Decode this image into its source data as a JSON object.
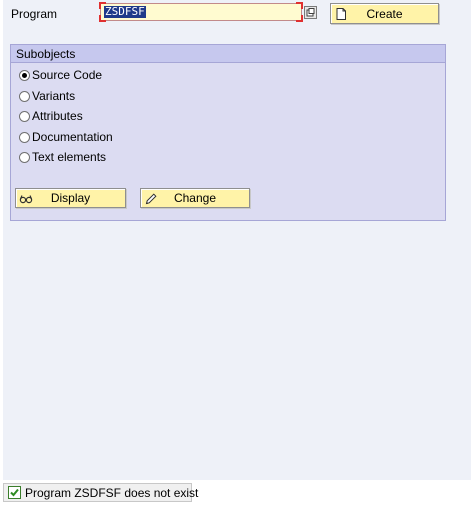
{
  "program": {
    "label": "Program",
    "value": "ZSDFSF"
  },
  "toolbar": {
    "create_label": "Create",
    "create_icon": "document-icon",
    "f4_icon": "value-help-icon"
  },
  "subobjects": {
    "title": "Subobjects",
    "options": [
      {
        "label": "Source Code",
        "selected": true
      },
      {
        "label": "Variants",
        "selected": false
      },
      {
        "label": "Attributes",
        "selected": false
      },
      {
        "label": "Documentation",
        "selected": false
      },
      {
        "label": "Text elements",
        "selected": false
      }
    ]
  },
  "actions": {
    "display_label": "Display",
    "display_icon": "glasses-icon",
    "change_label": "Change",
    "change_icon": "pencil-icon"
  },
  "status": {
    "message": "Program ZSDFSF does not exist",
    "type": "success",
    "icon": "checkmark-icon"
  },
  "colors": {
    "background": "#eef1f8",
    "button": "#fff3a8",
    "group_box": "#dcdcf2",
    "input": "#fffbd0",
    "selection": "#1f3a8a"
  }
}
